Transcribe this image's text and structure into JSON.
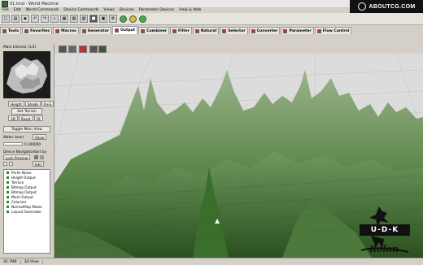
{
  "window": {
    "title": "01.tmd - World Machine"
  },
  "watermark": {
    "text": "ABOUTCG.COM"
  },
  "menu": [
    "File",
    "Edit",
    "World Commands",
    "Device Commands",
    "Views",
    "Devices",
    "Parameter Devices",
    "Help & Web"
  ],
  "tabs": [
    {
      "label": "Tools"
    },
    {
      "label": "Favorites"
    },
    {
      "label": "Macros"
    },
    {
      "label": "Generator"
    },
    {
      "label": "Output",
      "active": true
    },
    {
      "label": "Combiner"
    },
    {
      "label": "Filter"
    },
    {
      "label": "Natural"
    },
    {
      "label": "Selector"
    },
    {
      "label": "Converter"
    },
    {
      "label": "Parameter"
    },
    {
      "label": "Flow Control"
    }
  ],
  "left_panel": {
    "header": "Main Extents (1/2)",
    "view_buttons": [
      "Height",
      "Shade",
      "R+S"
    ],
    "set_terrain_label": "Set Terrain Color",
    "view3d_buttons": [
      "3D",
      "Reset",
      "Fit"
    ],
    "toggle_label": "Toggle Main View",
    "water_level_label": "Water Level",
    "water_show_label": "Show",
    "water_value": "0.100000",
    "device_nav_label": "Device Navigation",
    "sort_label": "Sort by",
    "lock_preview_label": "Lock Preview",
    "edit_label": "Edit",
    "devices": [
      "Perlin Noise",
      "Height Output",
      "Terrace",
      "Bitmap Output",
      "Bitmap Output",
      "Mesh Output",
      "Colorizer",
      "NormalMap Maker",
      "Layout Generator"
    ]
  },
  "status_bar": {
    "memory": "35.7MB",
    "view": "3D View"
  },
  "overlay": {
    "logo_text": "U-D-K",
    "signature": "Rolon"
  },
  "colors": {
    "terrain_dark": "#2f5a23",
    "terrain_light": "#8aa77b",
    "sky": "#dcdcdc",
    "accent_red": "#b33344"
  }
}
